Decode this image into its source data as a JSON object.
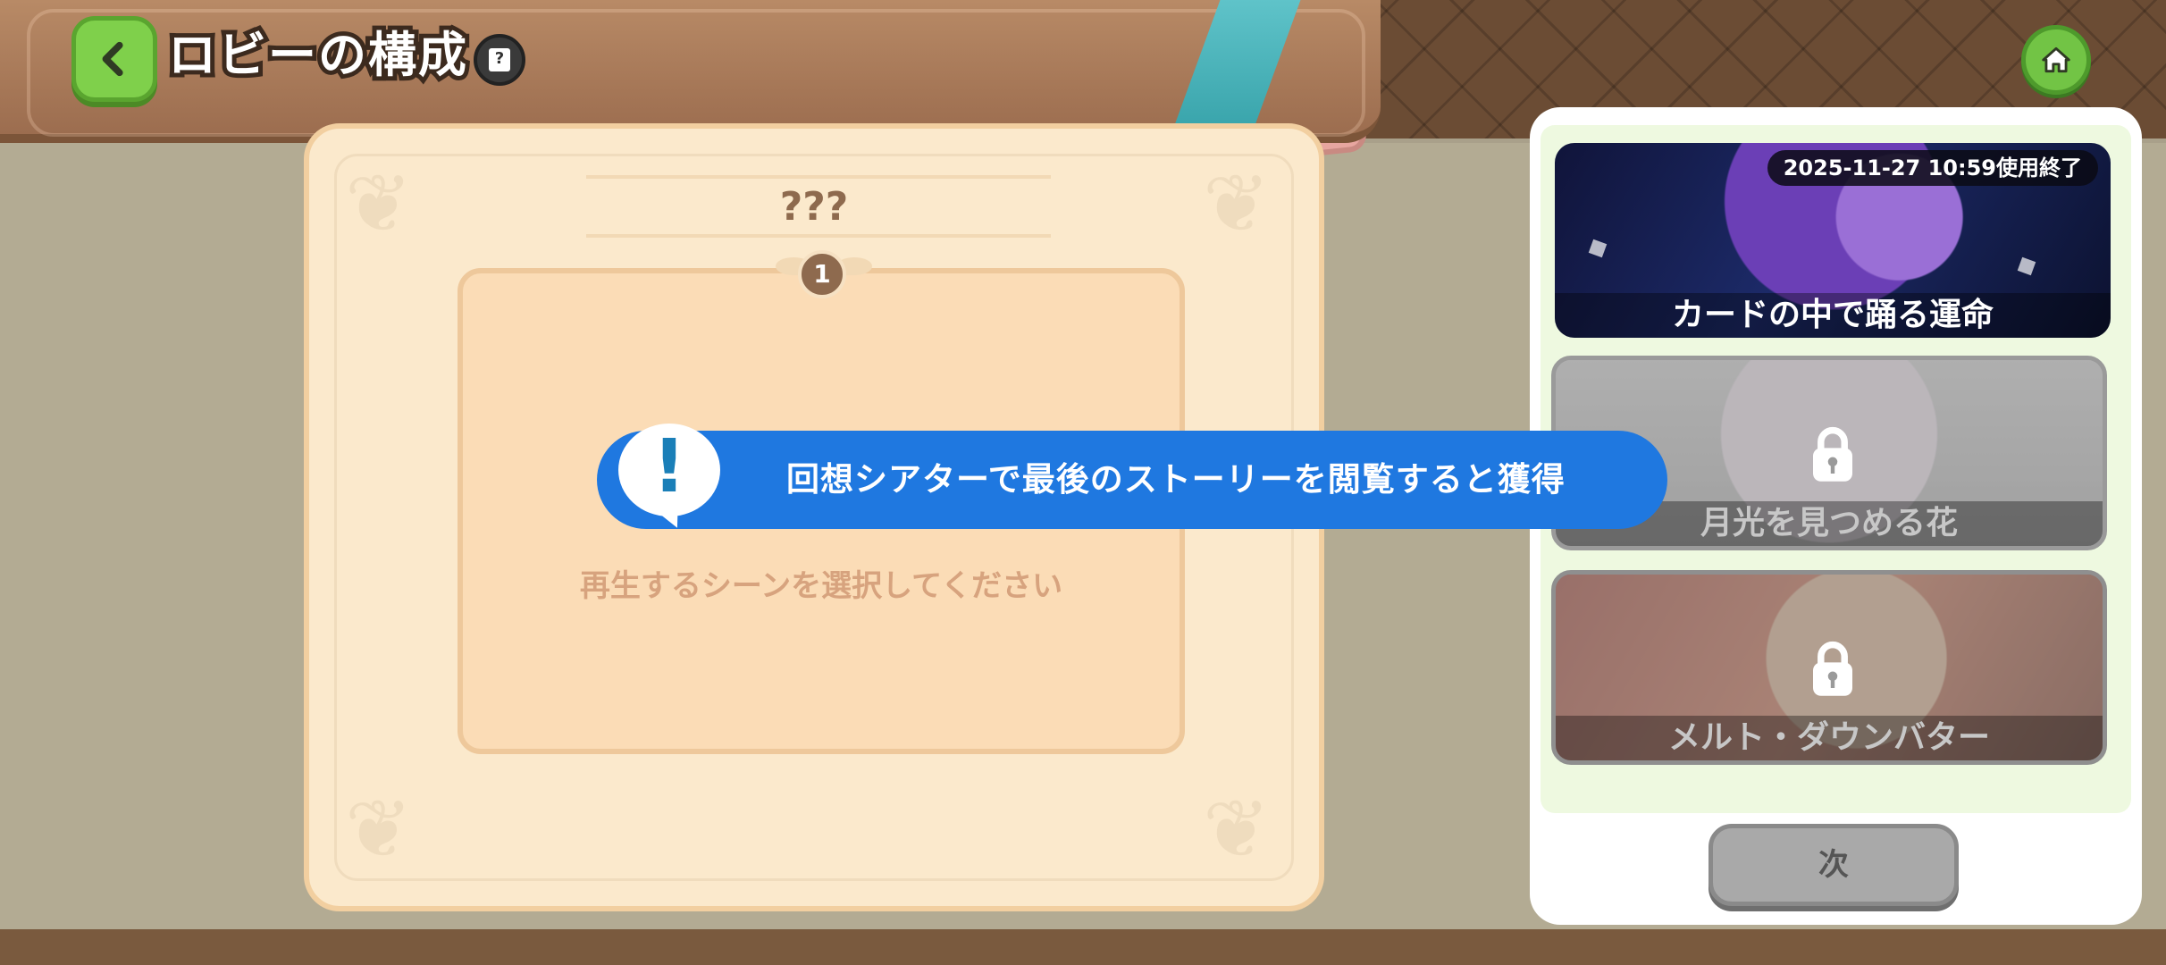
{
  "header": {
    "title": "ロビーの構成",
    "help_glyph": "?"
  },
  "main": {
    "title": "???",
    "scene_number": "1",
    "scene_hint": "再生するシーンを選択してください"
  },
  "banner": {
    "mark": "!",
    "text": "回想シアターで最後のストーリーを閲覧すると獲得"
  },
  "cards": [
    {
      "title": "カードの中で踊る運命",
      "date": "2025-11-27 10:59使用終了",
      "locked": false
    },
    {
      "title": "月光を見つめる花",
      "locked": true
    },
    {
      "title": "メルト・ダウンバター",
      "locked": true
    }
  ],
  "next_button": "次",
  "colors": {
    "accent_green": "#7fd04b",
    "banner_blue": "#1f78e0",
    "panel_cream": "#fbe9cc",
    "title_brown": "#8e6a4e"
  },
  "icons": [
    "back-arrow-icon",
    "help-icon",
    "home-icon",
    "lock-icon",
    "exclamation-bubble-icon"
  ]
}
